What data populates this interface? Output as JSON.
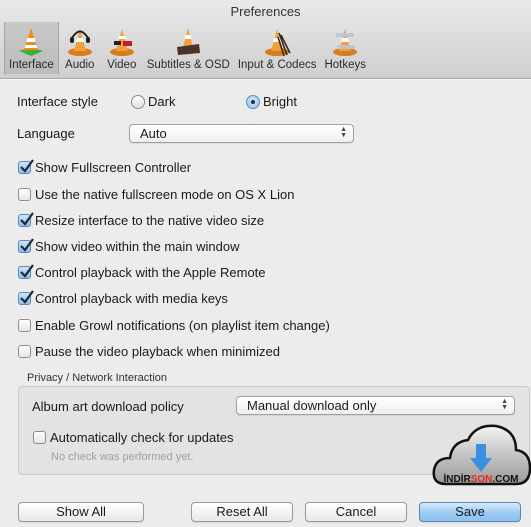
{
  "window": {
    "title": "Preferences"
  },
  "tabs": [
    {
      "label": "Interface",
      "icon": "vlc-cone-interface-icon",
      "active": true
    },
    {
      "label": "Audio",
      "icon": "vlc-cone-headphones-icon",
      "active": false
    },
    {
      "label": "Video",
      "icon": "vlc-cone-glasses-icon",
      "active": false
    },
    {
      "label": "Subtitles & OSD",
      "icon": "vlc-cone-clapper-icon",
      "active": false
    },
    {
      "label": "Input & Codecs",
      "icon": "vlc-cone-cables-icon",
      "active": false
    },
    {
      "label": "Hotkeys",
      "icon": "vlc-cone-keyboard-icon",
      "active": false
    }
  ],
  "interface_style": {
    "label": "Interface style",
    "options": [
      {
        "label": "Dark",
        "selected": false
      },
      {
        "label": "Bright",
        "selected": true
      }
    ]
  },
  "language": {
    "label": "Language",
    "value": "Auto"
  },
  "checkboxes": [
    {
      "label": "Show Fullscreen Controller",
      "checked": true
    },
    {
      "label": "Use the native fullscreen mode on OS X Lion",
      "checked": false
    },
    {
      "label": "Resize interface to the native video size",
      "checked": true
    },
    {
      "label": "Show video within the main window",
      "checked": true
    },
    {
      "label": "Control playback with the Apple Remote",
      "checked": true
    },
    {
      "label": "Control playback with media keys",
      "checked": true
    },
    {
      "label": "Enable Growl notifications (on playlist item change)",
      "checked": false
    },
    {
      "label": "Pause the video playback when minimized",
      "checked": false
    }
  ],
  "privacy": {
    "group_label": "Privacy / Network Interaction",
    "album_art_label": "Album art download policy",
    "album_art_value": "Manual download only",
    "auto_update_label": "Automatically check for updates",
    "auto_update_checked": false,
    "update_status": "No check was performed yet."
  },
  "buttons": {
    "show_all": "Show All",
    "reset_all": "Reset All",
    "cancel": "Cancel",
    "save": "Save"
  },
  "watermark": {
    "text_a": "İNDİR",
    "text_b": "SON",
    "text_c": ".COM"
  },
  "colors": {
    "accent_blue": "#8ec2f1",
    "watermark_red": "#e32b1e",
    "arrow_blue": "#3b8fe0"
  }
}
